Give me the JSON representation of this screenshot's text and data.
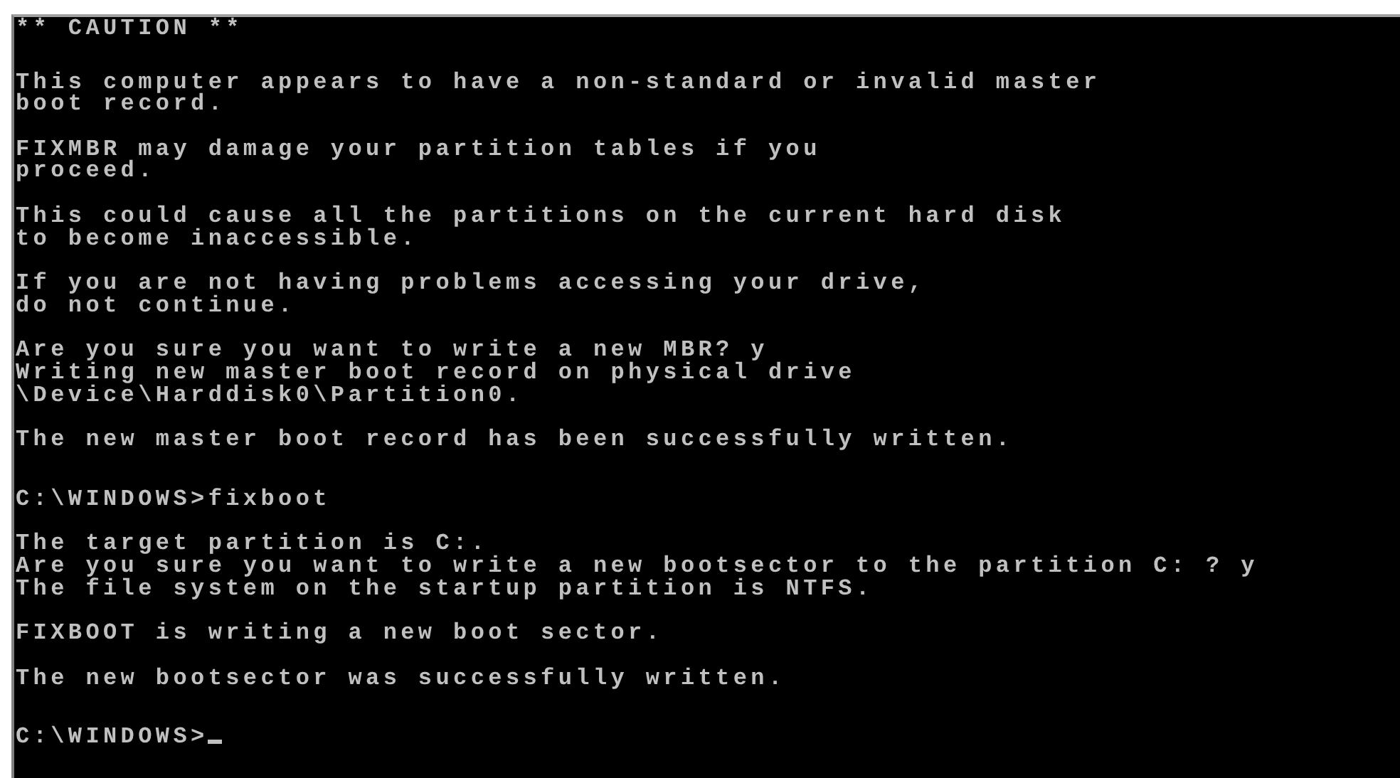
{
  "console": {
    "blocks": [
      {
        "kind": "text",
        "lines": [
          "** CAUTION **"
        ]
      },
      {
        "kind": "text",
        "lines": [
          "This computer appears to have a non-standard or invalid master",
          "boot record."
        ]
      },
      {
        "kind": "text",
        "lines": [
          "FIXMBR may damage your partition tables if you",
          "proceed."
        ]
      },
      {
        "kind": "text",
        "lines": [
          "This could cause all the partitions on the current hard disk",
          "to become inaccessible."
        ]
      },
      {
        "kind": "text",
        "lines": [
          "If you are not having problems accessing your drive,",
          "do not continue."
        ]
      },
      {
        "kind": "text",
        "lines": [
          "Are you sure you want to write a new MBR? y",
          "Writing new master boot record on physical drive",
          "\\Device\\Harddisk0\\Partition0."
        ]
      },
      {
        "kind": "text",
        "lines": [
          "The new master boot record has been successfully written."
        ]
      },
      {
        "kind": "command",
        "lines": [
          "C:\\WINDOWS>fixboot"
        ]
      },
      {
        "kind": "text",
        "lines": [
          "The target partition is C:.",
          "Are you sure you want to write a new bootsector to the partition C: ? y",
          "The file system on the startup partition is NTFS."
        ]
      },
      {
        "kind": "text",
        "lines": [
          "FIXBOOT is writing a new boot sector."
        ]
      },
      {
        "kind": "text",
        "lines": [
          "The new bootsector was successfully written."
        ]
      },
      {
        "kind": "prompt",
        "lines": [
          "C:\\WINDOWS>"
        ]
      }
    ]
  }
}
